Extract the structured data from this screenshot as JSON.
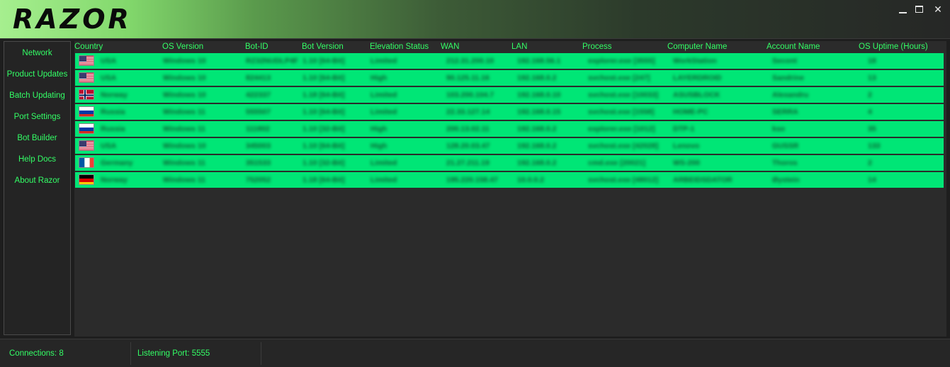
{
  "app": {
    "title": "RAZOR"
  },
  "window_controls": {
    "minimize": "—",
    "maximize": "☐",
    "close": "✕"
  },
  "sidebar": {
    "items": [
      {
        "label": "Network"
      },
      {
        "label": "Product Updates"
      },
      {
        "label": "Batch Updating"
      },
      {
        "label": "Port Settings"
      },
      {
        "label": "Bot Builder"
      },
      {
        "label": "Help Docs"
      },
      {
        "label": "About Razor"
      }
    ]
  },
  "table": {
    "columns": [
      "Country",
      "OS Version",
      "Bot-ID",
      "Bot Version",
      "Elevation Status",
      "WAN",
      "LAN",
      "Process",
      "Computer Name",
      "Account Name",
      "OS Uptime (Hours)"
    ],
    "rows": [
      {
        "flag": "us-flag-icon",
        "cells": [
          "USA",
          "Windows 10",
          "RZ32NUDLP4F",
          "1.10 [64-Bit]",
          "Limited",
          "212.31.200.10",
          "192.168.56.1",
          "explorer.exe [3555]",
          "WorkStation",
          "Secont",
          "18"
        ]
      },
      {
        "flag": "us-flag-icon",
        "cells": [
          "USA",
          "Windows 10",
          "824413",
          "1.10 [64-Bit]",
          "High",
          "90.125.11.16",
          "192.168.0.2",
          "svchost.exe [247]",
          "LAYERDROID",
          "Sandrine",
          "13"
        ]
      },
      {
        "flag": "norway-flag-icon",
        "cells": [
          "Norway",
          "Windows 10",
          "422337",
          "1.18 [64-Bit]",
          "Limited",
          "103.200.104.7",
          "192.168.0.10",
          "svchost.exe [10033]",
          "ASUSBLOCK",
          "Alexandru",
          "2"
        ]
      },
      {
        "flag": "russia-flag-icon",
        "cells": [
          "Russia",
          "Windows 11",
          "555507",
          "1.10 [64-Bit]",
          "Limited",
          "22.33.127.14",
          "192.168.0.15",
          "svchost.exe [1558]",
          "HOME-PC",
          "SERRA",
          "4"
        ]
      },
      {
        "flag": "russia-flag-icon",
        "cells": [
          "Russia",
          "Windows 11",
          "111802",
          "1.10 [32-Bit]",
          "High",
          "200.13.02.11",
          "192.168.0.2",
          "explorer.exe [1012]",
          "DTP-1",
          "kso",
          "35"
        ]
      },
      {
        "flag": "us-flag-icon",
        "cells": [
          "USA",
          "Windows 10",
          "345003",
          "1.10 [64-Bit]",
          "High",
          "128.20.03.47",
          "192.168.0.2",
          "svchost.exe [42028]",
          "Lenovo",
          "GUSSR",
          "133"
        ]
      },
      {
        "flag": "france-flag-icon",
        "cells": [
          "Germany",
          "Windows 11",
          "351533",
          "1.10 [32-Bit]",
          "Limited",
          "21.27.211.19",
          "192.168.0.2",
          "cmd.exe [20021]",
          "WS-200",
          "Thoros",
          "2"
        ]
      },
      {
        "flag": "germany-flag-icon",
        "cells": [
          "Norway",
          "Windows 11",
          "752052",
          "1.18 [64-Bit]",
          "Limited",
          "195.220.158.47",
          "10.0.0.2",
          "svchost.exe [48012]",
          "ARBEIDSDATOR",
          "Øystein",
          "14"
        ]
      }
    ]
  },
  "status": {
    "connections": "Connections: 8",
    "listening_port": "Listening Port: 5555"
  },
  "colors": {
    "accent_text": "#33ff66",
    "row_background": "#00e676",
    "background": "#1e1e1e"
  }
}
